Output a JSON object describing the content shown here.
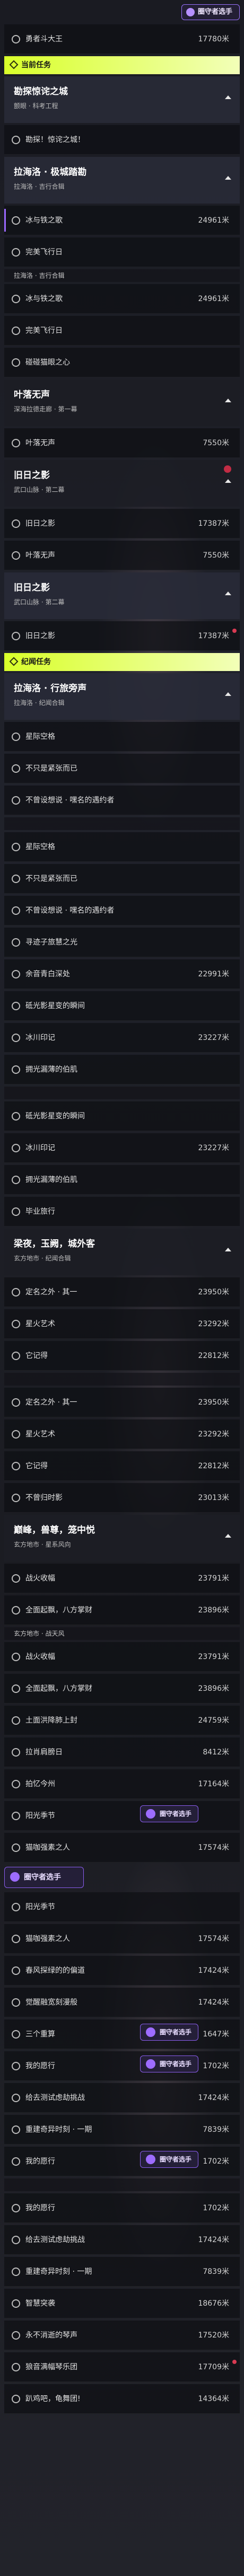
{
  "badge_top": {
    "label": "圈守者选手"
  },
  "rows": [
    {
      "kind": "quest",
      "title": "勇者斗大王",
      "dist": "17780米"
    },
    {
      "kind": "header",
      "label": "当前任务",
      "style": "main"
    },
    {
      "kind": "chapter",
      "title": "勘探惊诧之城",
      "subtitle": "颤眼 · 科考工程",
      "selected": true
    },
    {
      "kind": "quest",
      "title": "勘探！惊诧之城！",
      "dist": ""
    },
    {
      "kind": "chapter",
      "title": "拉海洛 · 极城踏勘",
      "subtitle": "拉海洛 · 吉行合辑",
      "selected": true
    },
    {
      "kind": "quest",
      "title": "冰与铁之歌",
      "dist": "24961米",
      "active": true
    },
    {
      "kind": "quest",
      "title": "完美飞行日",
      "dist": ""
    },
    {
      "kind": "section",
      "label": "拉海洛 · 吉行合辑"
    },
    {
      "kind": "quest",
      "title": "冰与铁之歌",
      "dist": "24961米"
    },
    {
      "kind": "quest",
      "title": "完美飞行日",
      "dist": ""
    },
    {
      "kind": "quest",
      "title": "碰碰猫眼之心",
      "dist": ""
    },
    {
      "kind": "chapter",
      "title": "叶落无声",
      "subtitle": "深海拉德走廊 · 第一幕"
    },
    {
      "kind": "quest",
      "title": "叶落无声",
      "dist": "7550米"
    },
    {
      "kind": "chapter",
      "title": "旧日之影",
      "subtitle": "武口山脉 · 第二幕",
      "marker": true
    },
    {
      "kind": "quest",
      "title": "旧日之影",
      "dist": "17387米"
    },
    {
      "kind": "quest",
      "title": "叶落无声",
      "dist": "7550米"
    },
    {
      "kind": "chapter",
      "title": "旧日之影",
      "subtitle": "武口山脉 · 第二幕",
      "selected": true
    },
    {
      "kind": "quest",
      "title": "旧日之影",
      "dist": "17387米",
      "marker": true
    },
    {
      "kind": "header",
      "label": "纪闻任务",
      "style": "main"
    },
    {
      "kind": "chapter",
      "title": "拉海洛 · 行旅旁声",
      "subtitle": "拉海洛 · 纪闻合辑",
      "selected": true
    },
    {
      "kind": "quest",
      "title": "星际空格",
      "dist": ""
    },
    {
      "kind": "quest",
      "title": "不只是紧张而已",
      "dist": ""
    },
    {
      "kind": "quest",
      "title": "不曾设想说 · 嘿名的遇约者",
      "dist": ""
    },
    {
      "kind": "section",
      "label": ""
    },
    {
      "kind": "quest",
      "title": "星际空格",
      "dist": ""
    },
    {
      "kind": "quest",
      "title": "不只是紧张而已",
      "dist": ""
    },
    {
      "kind": "quest",
      "title": "不曾设想说 · 嘿名的遇约者",
      "dist": ""
    },
    {
      "kind": "quest",
      "title": "寻迹子旅慧之光",
      "dist": ""
    },
    {
      "kind": "quest",
      "title": "余音青白深处",
      "dist": "22991米"
    },
    {
      "kind": "quest",
      "title": "砥光影星变的瞬间",
      "dist": ""
    },
    {
      "kind": "quest",
      "title": "冰川印记",
      "dist": "23227米"
    },
    {
      "kind": "quest",
      "title": "拥光漏薄的伯肌",
      "dist": ""
    },
    {
      "kind": "section",
      "label": ""
    },
    {
      "kind": "quest",
      "title": "砥光影星变的瞬间",
      "dist": ""
    },
    {
      "kind": "quest",
      "title": "冰川印记",
      "dist": "23227米"
    },
    {
      "kind": "quest",
      "title": "拥光漏薄的伯肌",
      "dist": ""
    },
    {
      "kind": "quest",
      "title": "毕业旅行",
      "dist": ""
    },
    {
      "kind": "chapter",
      "title": "梁夜，玉阙，城外客",
      "subtitle": "玄方地市 · 纪闻合辑"
    },
    {
      "kind": "quest",
      "title": "定名之外 · 其一",
      "dist": "23950米"
    },
    {
      "kind": "quest",
      "title": "星火艺术",
      "dist": "23292米"
    },
    {
      "kind": "quest",
      "title": "它记得",
      "dist": "22812米"
    },
    {
      "kind": "section",
      "label": ""
    },
    {
      "kind": "quest",
      "title": "定名之外 · 其一",
      "dist": "23950米"
    },
    {
      "kind": "quest",
      "title": "星火艺术",
      "dist": "23292米"
    },
    {
      "kind": "quest",
      "title": "它记得",
      "dist": "22812米"
    },
    {
      "kind": "quest",
      "title": "不曾归时影",
      "dist": "23013米"
    },
    {
      "kind": "chapter",
      "title": "巅峰，兽尊，笼中悦",
      "subtitle": "玄方地市 · 星系风向"
    },
    {
      "kind": "quest",
      "title": "战火收幅",
      "dist": "23791米"
    },
    {
      "kind": "quest",
      "title": "全面起飘，八方掌财",
      "dist": "23896米"
    },
    {
      "kind": "section",
      "label": "玄方地市 · 战天风"
    },
    {
      "kind": "quest",
      "title": "战火收幅",
      "dist": "23791米"
    },
    {
      "kind": "quest",
      "title": "全面起飘，八方掌财",
      "dist": "23896米"
    },
    {
      "kind": "quest",
      "title": "土面洪降肺上封",
      "dist": "24759米"
    },
    {
      "kind": "quest",
      "title": "拉肖肩膀日",
      "dist": "8412米"
    },
    {
      "kind": "quest",
      "title": "拍忆今州",
      "dist": "17164米"
    },
    {
      "kind": "quest",
      "title": "阳光季节",
      "dist": "",
      "badge": true
    },
    {
      "kind": "quest",
      "title": "猫咖强素之人",
      "dist": "17574米"
    },
    {
      "kind": "badge_row"
    },
    {
      "kind": "quest",
      "title": "阳光季节",
      "dist": ""
    },
    {
      "kind": "quest",
      "title": "猫咖强素之人",
      "dist": "17574米"
    },
    {
      "kind": "quest",
      "title": "春风探绿的的偏道",
      "dist": "17424米"
    },
    {
      "kind": "quest",
      "title": "觉醒融宽刻漫般",
      "dist": "17424米"
    },
    {
      "kind": "quest",
      "title": "三个重算",
      "dist": "1647米",
      "badge": true
    },
    {
      "kind": "quest",
      "title": "我的愿行",
      "dist": "1702米",
      "badge": true
    },
    {
      "kind": "quest",
      "title": "给去测试虑劫挑战",
      "dist": "17424米"
    },
    {
      "kind": "quest",
      "title": "重建奇异时刻 · 一期",
      "dist": "7839米"
    },
    {
      "kind": "quest",
      "title": "我的愿行",
      "dist": "1702米",
      "badge": true
    },
    {
      "kind": "section",
      "label": ""
    },
    {
      "kind": "quest",
      "title": "我的愿行",
      "dist": "1702米"
    },
    {
      "kind": "quest",
      "title": "给去测试虑劫挑战",
      "dist": "17424米"
    },
    {
      "kind": "quest",
      "title": "重建奇异时刻 · 一期",
      "dist": "7839米"
    },
    {
      "kind": "quest",
      "title": "智慧突袭",
      "dist": "18676米"
    },
    {
      "kind": "quest",
      "title": "永不消逝的琴声",
      "dist": "17520米"
    },
    {
      "kind": "quest",
      "title": "狼音满幅琴乐团",
      "dist": "17709米",
      "marker": true
    },
    {
      "kind": "quest",
      "title": "趴鸡吧，龟舞团!",
      "dist": "14364米"
    }
  ],
  "badge_label": "圈守者选手",
  "bottom_text": "趴鸡吧，龟舞团!"
}
